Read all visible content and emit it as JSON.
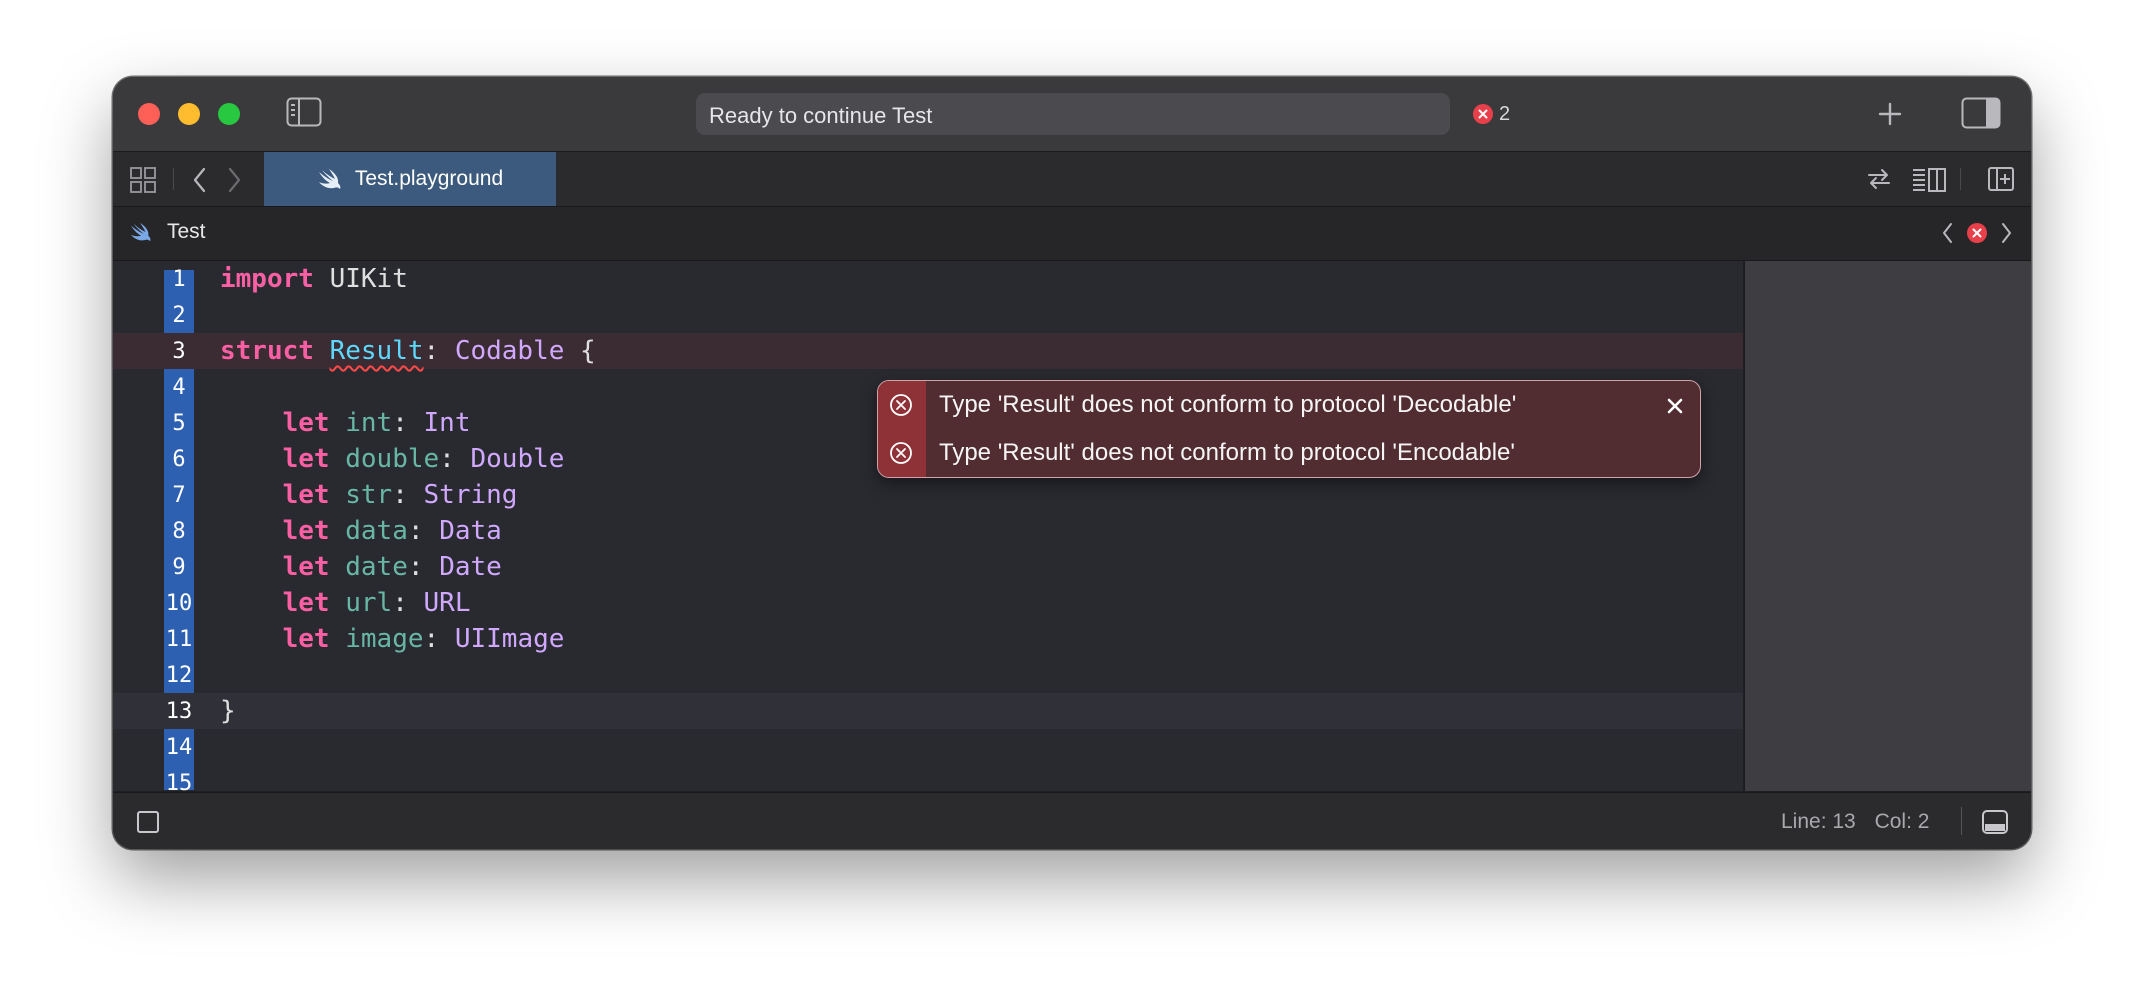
{
  "titlebar": {
    "activity_status": "Ready to continue Test",
    "error_count": "2"
  },
  "tabbar": {
    "active_tab": "Test.playground"
  },
  "jumpbar": {
    "breadcrumb": "Test"
  },
  "editor": {
    "line_numbers": [
      "1",
      "2",
      "3",
      "4",
      "5",
      "6",
      "7",
      "8",
      "9",
      "10",
      "11",
      "12",
      "13",
      "14",
      "15"
    ],
    "lines": [
      "import UIKit",
      "",
      "struct Result: Codable {",
      "",
      "    let int: Int",
      "    let double: Double",
      "    let str: String",
      "    let data: Data",
      "    let date: Date",
      "    let url: URL",
      "    let image: UIImage",
      "",
      "}",
      "",
      ""
    ],
    "error_line": 3,
    "current_line": 13
  },
  "errors": [
    "Type 'Result' does not conform to protocol 'Decodable'",
    "Type 'Result' does not conform to protocol 'Encodable'"
  ],
  "statusbar": {
    "line": "Line: 13",
    "col": "Col: 2"
  },
  "colors": {
    "keyword": "#fc5fa3",
    "type": "#d0a8ff",
    "property": "#67b7a4",
    "gutter": "#2e60b2",
    "error": "#e8404a",
    "tab_active": "#3b5a7d"
  },
  "icons": [
    "sidebar-icon",
    "error-icon",
    "plus-icon",
    "inspector-icon",
    "grid-icon",
    "chevron-left-icon",
    "chevron-right-icon",
    "swift-icon",
    "swap-icon",
    "adjust-editor-icon",
    "add-editor-icon",
    "close-icon",
    "console-icon"
  ]
}
